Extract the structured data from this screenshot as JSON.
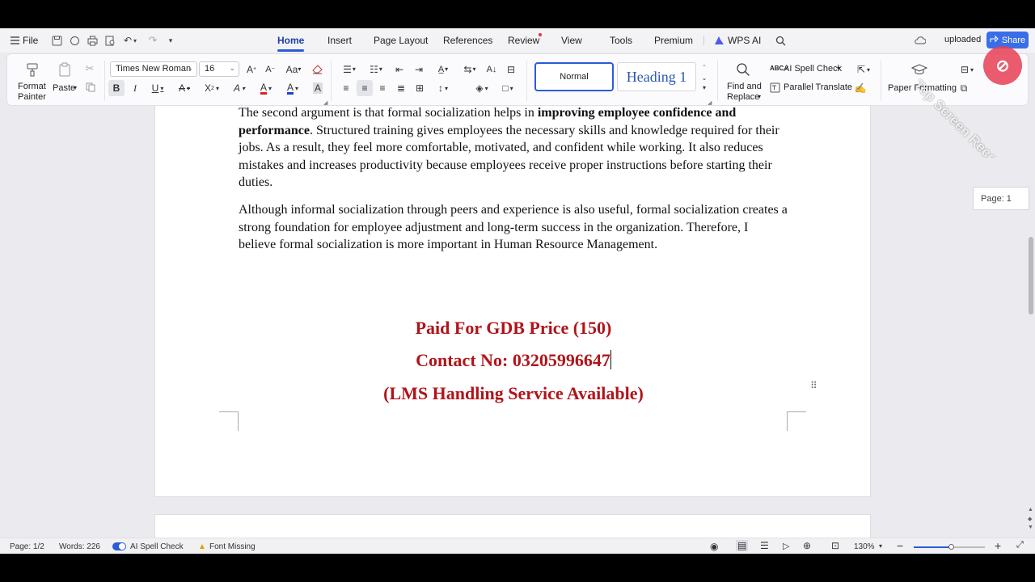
{
  "menubar": {
    "file_label": "File",
    "tabs": [
      "Home",
      "Insert",
      "Page Layout",
      "References",
      "Review",
      "View",
      "Tools",
      "Premium",
      "WPS AI"
    ],
    "uploaded_label": "uploaded",
    "share_label": "Share"
  },
  "ribbon": {
    "format_painter_label": "Format\nPainter",
    "paste_label": "Paste",
    "font_name": "Times New Roman",
    "font_size": "16",
    "style_normal": "Normal",
    "style_heading1": "Heading 1",
    "find_replace_label": "Find and\nReplace",
    "ai_spell_check_label": "AI Spell Check",
    "parallel_translate_label": "Parallel Translate",
    "paper_formatting_label": "Paper Formatting",
    "bold_glyph": "B",
    "italic_glyph": "I",
    "underline_glyph": "U"
  },
  "document": {
    "para1_prefix": "The second argument is that formal socialization helps in ",
    "para1_bold": "improving employee confidence and performance",
    "para1_rest": ". Structured training gives employees the necessary skills and knowledge required for their jobs. As a result, they feel more comfortable, motivated, and confident while working. It also reduces mistakes and increases productivity because employees receive proper instructions before starting their duties.",
    "para2": "Although informal socialization through peers and experience is also useful, formal socialization creates a strong foundation for employee adjustment and long-term success in the organization. Therefore, I believe formal socialization is more important in Human Resource Management.",
    "red_line1": "Paid For GDB Price (150)",
    "red_line2": "Contact No: 03205996647",
    "red_line3": "(LMS Handling Service Available)"
  },
  "side": {
    "page_indicator": "Page: 1"
  },
  "status": {
    "page": "Page: 1/2",
    "words": "Words: 226",
    "ai_spell_check": "AI Spell Check",
    "font_missing": "Font Missing",
    "zoom": "130%"
  },
  "watermark_text": "Top Screen Recorder",
  "colors": {
    "accent": "#2b5bd7",
    "red_text": "#b0141a",
    "share_button": "#3a6ee8"
  }
}
